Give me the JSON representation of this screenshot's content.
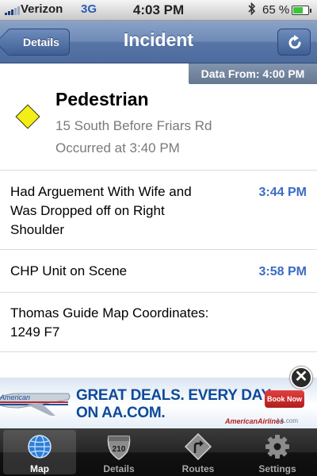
{
  "status_bar": {
    "carrier": "Verizon",
    "network": "3G",
    "time": "4:03 PM",
    "battery": "65 %",
    "battery_level": 0.65
  },
  "nav": {
    "back_label": "Details",
    "title": "Incident",
    "refresh_icon": "refresh-icon"
  },
  "data_from": "Data From: 4:00 PM",
  "incident": {
    "type": "Pedestrian",
    "location": "15 South Before Friars Rd",
    "occurred": "Occurred at 3:40 PM",
    "icon_color": "#f4ee17"
  },
  "updates": [
    {
      "line1": "Had Arguement With Wife and",
      "line2": "Was Dropped off on Right",
      "line3": "Shoulder",
      "time": "3:44 PM"
    },
    {
      "line1": "CHP Unit on Scene",
      "time": "3:58 PM"
    },
    {
      "line1": "Thomas Guide Map Coordinates:",
      "line2": "1249 F7"
    }
  ],
  "ad": {
    "logo_text": "American",
    "headline1": "GREAT DEALS. EVERY DAY.",
    "headline2": "ON AA.COM.",
    "cta": "Book Now",
    "brand": "AmericanAirlines",
    "brand_url": "AA.com"
  },
  "tabs": [
    {
      "label": "Map",
      "icon": "globe-icon",
      "active": true
    },
    {
      "label": "Details",
      "icon": "highway-shield-icon",
      "badge": "210",
      "active": false
    },
    {
      "label": "Routes",
      "icon": "route-sign-icon",
      "active": false
    },
    {
      "label": "Settings",
      "icon": "gear-icon",
      "active": false
    }
  ],
  "colors": {
    "accent_time": "#3a6bc6",
    "nav": "#5875a6"
  }
}
